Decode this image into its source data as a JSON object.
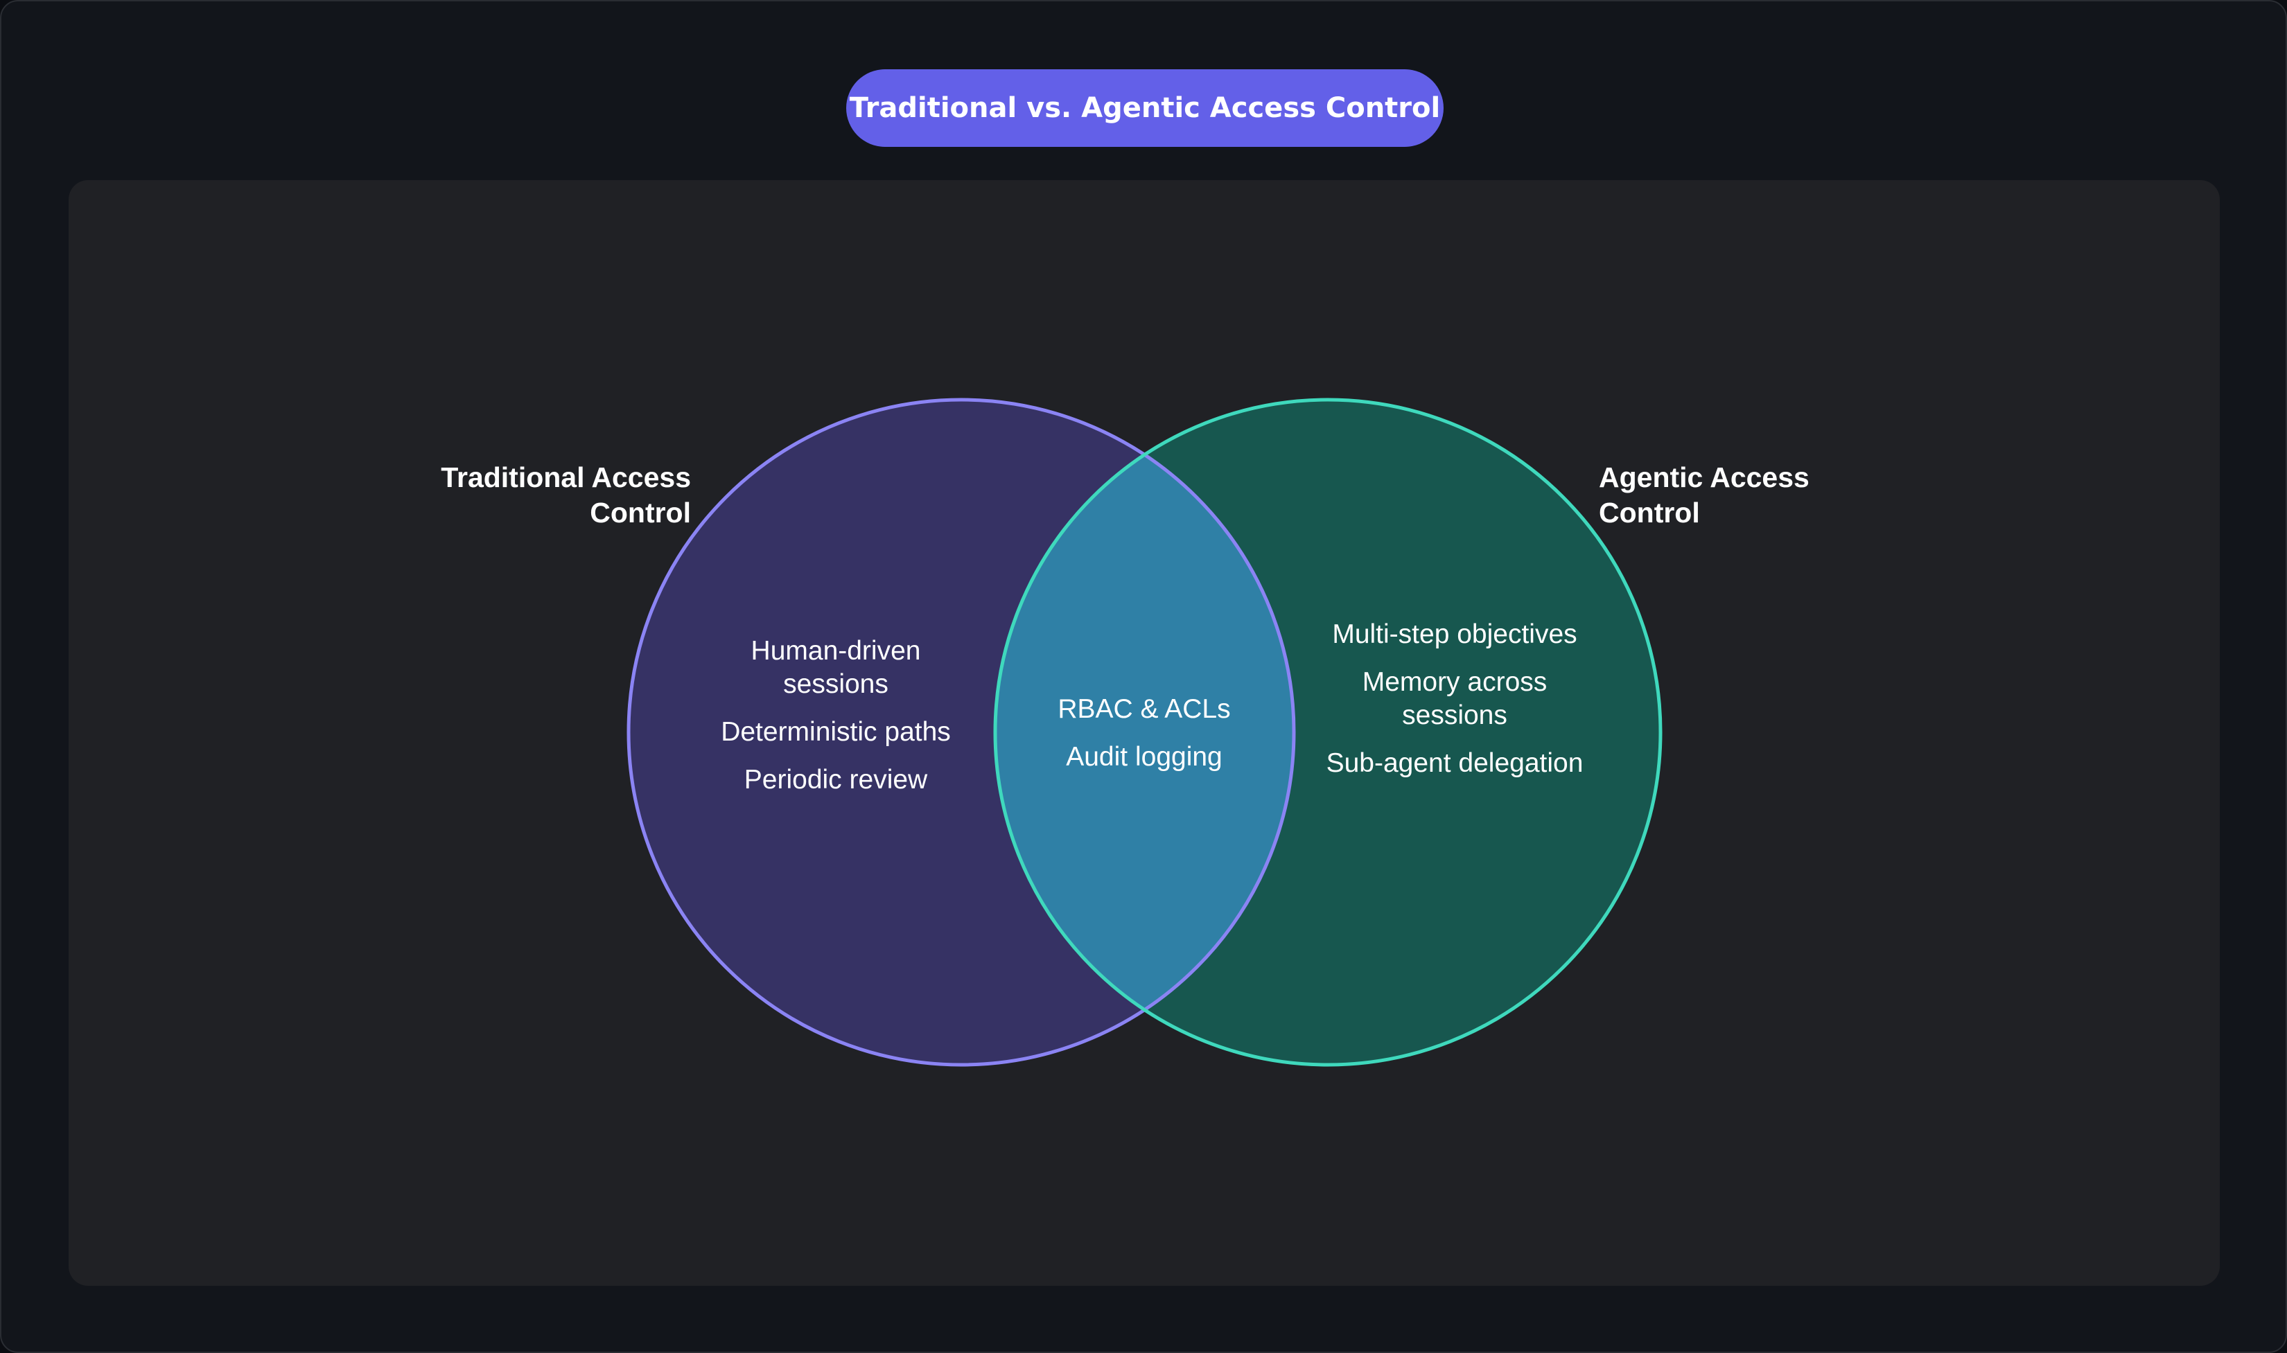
{
  "title": "Traditional vs. Agentic Access Control",
  "colors": {
    "background": "#12151b",
    "panel": "#202125",
    "title_pill": "#6360e8",
    "left_fill": "#363264",
    "left_stroke": "#8b84f4",
    "right_fill": "#17574f",
    "right_stroke": "#3fd9bd",
    "overlap_fill": "#2f80a6",
    "text": "#ffffff"
  },
  "sets": {
    "left": {
      "label": "Traditional Access Control",
      "items": [
        "Human-driven sessions",
        "Deterministic paths",
        "Periodic review"
      ]
    },
    "right": {
      "label": "Agentic Access Control",
      "items": [
        "Multi-step objectives",
        "Memory across sessions",
        "Sub-agent delegation"
      ]
    },
    "intersection": {
      "items": [
        "RBAC & ACLs",
        "Audit logging"
      ]
    }
  }
}
